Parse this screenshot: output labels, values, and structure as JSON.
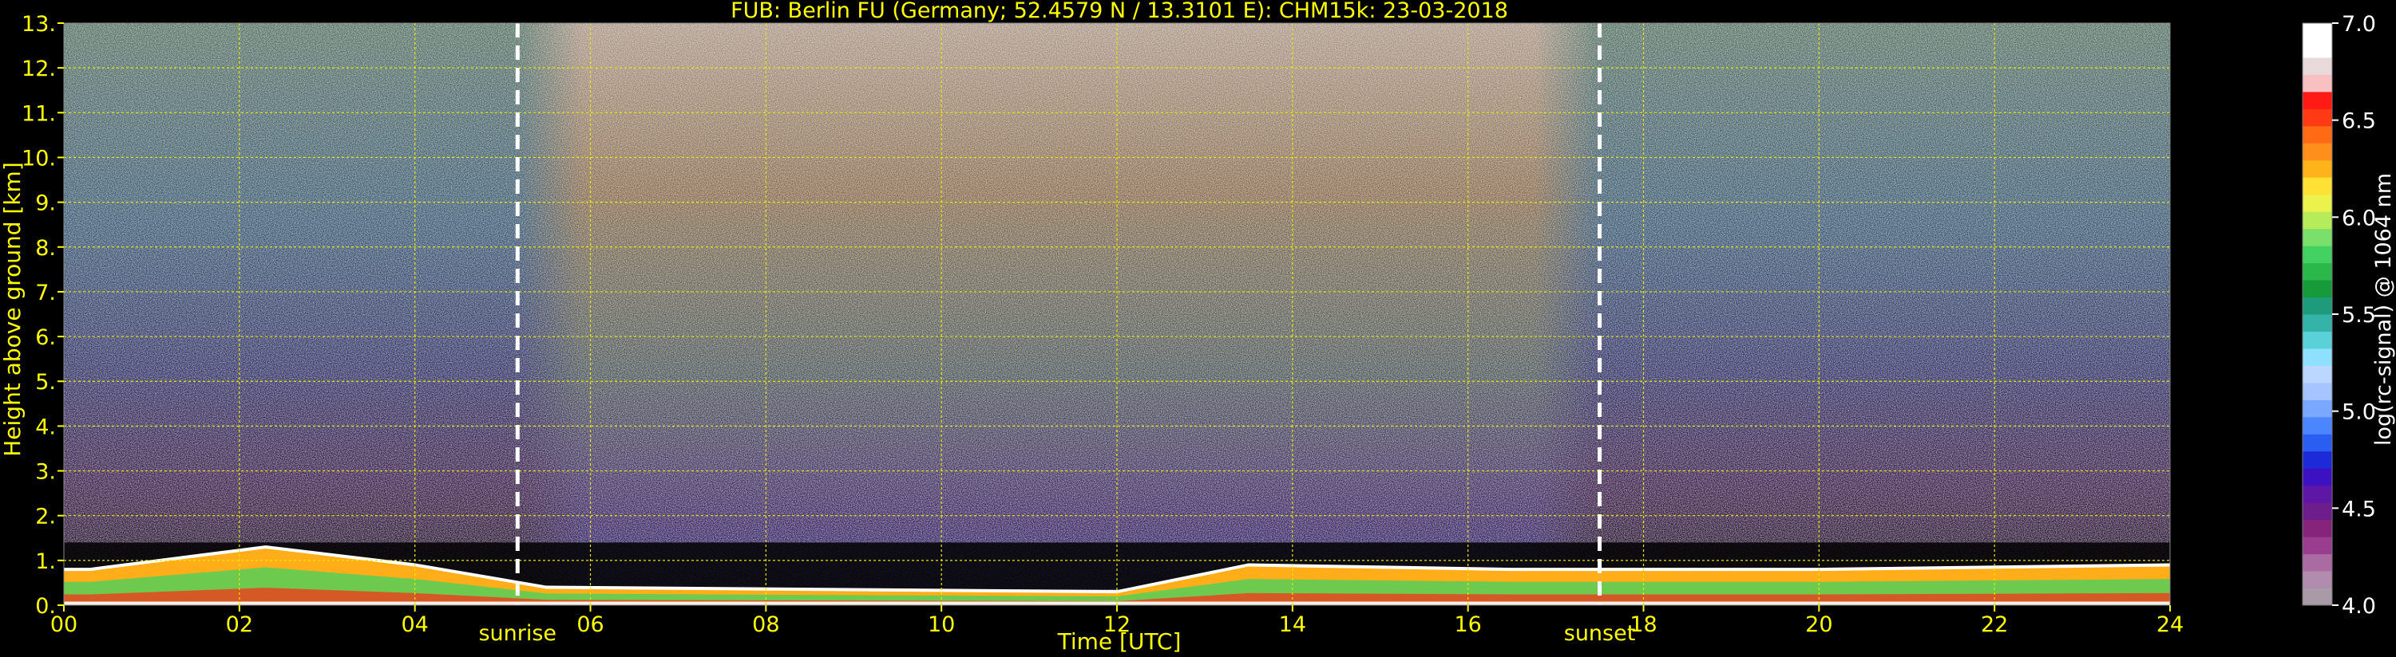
{
  "chart_data": {
    "type": "heatmap",
    "title": "FUB: Berlin FU (Germany; 52.4579 N / 13.3101 E):    CHM15k: 23-03-2018",
    "xlabel": "Time [UTC]",
    "ylabel": "Height above ground [km]",
    "xlim": [
      0,
      24
    ],
    "ylim": [
      0,
      13
    ],
    "x_ticks": [
      "00",
      "02",
      "04",
      "06",
      "08",
      "10",
      "12",
      "14",
      "16",
      "18",
      "20",
      "22",
      "24"
    ],
    "y_ticks": [
      "0.",
      "1.",
      "2.",
      "3.",
      "4.",
      "5.",
      "6.",
      "7.",
      "8.",
      "9.",
      "10.",
      "11.",
      "12.",
      "13."
    ],
    "grid": true,
    "events": [
      {
        "label": "sunrise",
        "time": 5.17
      },
      {
        "label": "sunset",
        "time": 17.5
      }
    ],
    "colorbar": {
      "label": "log(rc-signal) @ 1064 nm",
      "range": [
        4.0,
        7.0
      ],
      "ticks": [
        "4.0",
        "4.5",
        "5.0",
        "5.5",
        "6.0",
        "6.5",
        "7.0"
      ],
      "colors": [
        "#a89aa6",
        "#b28cae",
        "#aa6aa2",
        "#9a3d8f",
        "#86247c",
        "#6e1d8c",
        "#5d16a6",
        "#3c11c2",
        "#1d2ad8",
        "#2a5ef0",
        "#4b86ff",
        "#7aa8ff",
        "#a6c4ff",
        "#bcd7ff",
        "#8fe0ff",
        "#5ad0d9",
        "#34b4a8",
        "#1e9b7a",
        "#169a3a",
        "#2ab84a",
        "#43d162",
        "#7be06b",
        "#b6ec5a",
        "#eaf24b",
        "#ffe133",
        "#ffb31a",
        "#ff8f1a",
        "#ff6a14",
        "#ff3a14",
        "#ff1a14",
        "#f8c0c0",
        "#e8dada",
        "#ffffff",
        "#ffffff"
      ]
    },
    "profile_summary": [
      {
        "time": 0.3,
        "layer_top_km": 0.8
      },
      {
        "time": 2.3,
        "layer_top_km": 1.3
      },
      {
        "time": 4.0,
        "layer_top_km": 0.9
      },
      {
        "time": 5.5,
        "layer_top_km": 0.4
      },
      {
        "time": 12.0,
        "layer_top_km": 0.3
      },
      {
        "time": 13.5,
        "layer_top_km": 0.9
      },
      {
        "time": 16.5,
        "layer_top_km": 0.8
      },
      {
        "time": 20.0,
        "layer_top_km": 0.8
      },
      {
        "time": 24.0,
        "layer_top_km": 0.9
      }
    ]
  },
  "colors": {
    "axis_text": "#ffff00",
    "grid": "#e8e800",
    "background": "#000000",
    "event_line": "#ffffff"
  }
}
